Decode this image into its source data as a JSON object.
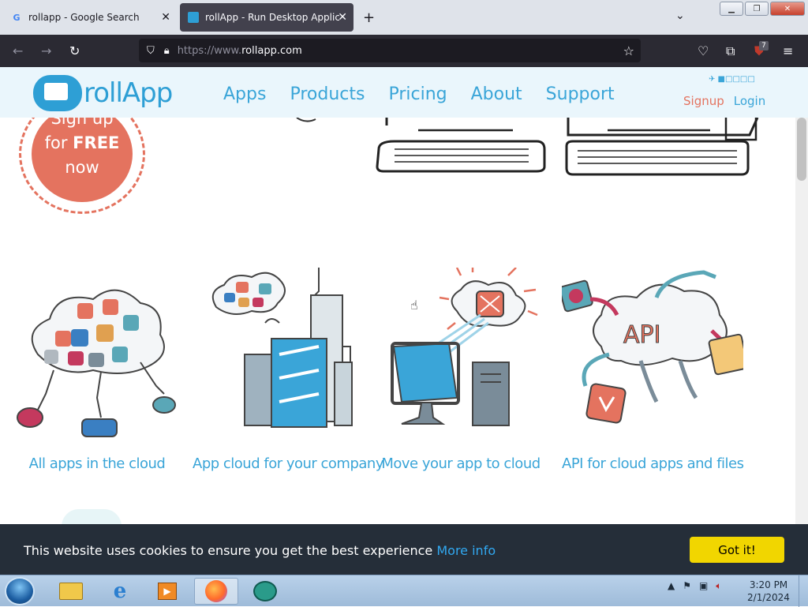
{
  "browser": {
    "tabs": [
      {
        "title": "rollapp - Google Search",
        "favicon": "G",
        "active": false
      },
      {
        "title": "rollApp - Run Desktop Applicat",
        "favicon": "rollapp-favicon",
        "active": true
      }
    ],
    "url_prefix": "https://www.",
    "url_domain": "rollapp.com",
    "extension_badge": "7"
  },
  "site": {
    "logo_text": "rollApp",
    "nav": [
      "Apps",
      "Products",
      "Pricing",
      "About",
      "Support"
    ],
    "signup": "Signup",
    "login": "Login",
    "signup_badge": {
      "line1": "Sign up",
      "line2": "for",
      "line3": "FREE",
      "line4": "now"
    },
    "features": [
      {
        "label": "All apps in the cloud"
      },
      {
        "label": "App cloud for your company"
      },
      {
        "label": "Move your app to cloud"
      },
      {
        "label": "API for cloud apps and files"
      }
    ]
  },
  "cookie": {
    "message": "This website uses cookies to ensure you get the best experience ",
    "more_info": "More info",
    "button": "Got it!"
  },
  "taskbar": {
    "time": "3:20 PM",
    "date": "2/1/2024"
  },
  "colors": {
    "brand_blue": "#3aa5d8",
    "signup_red": "#e4735f",
    "cookie_bg": "#252e39",
    "cookie_button": "#f1d600"
  }
}
